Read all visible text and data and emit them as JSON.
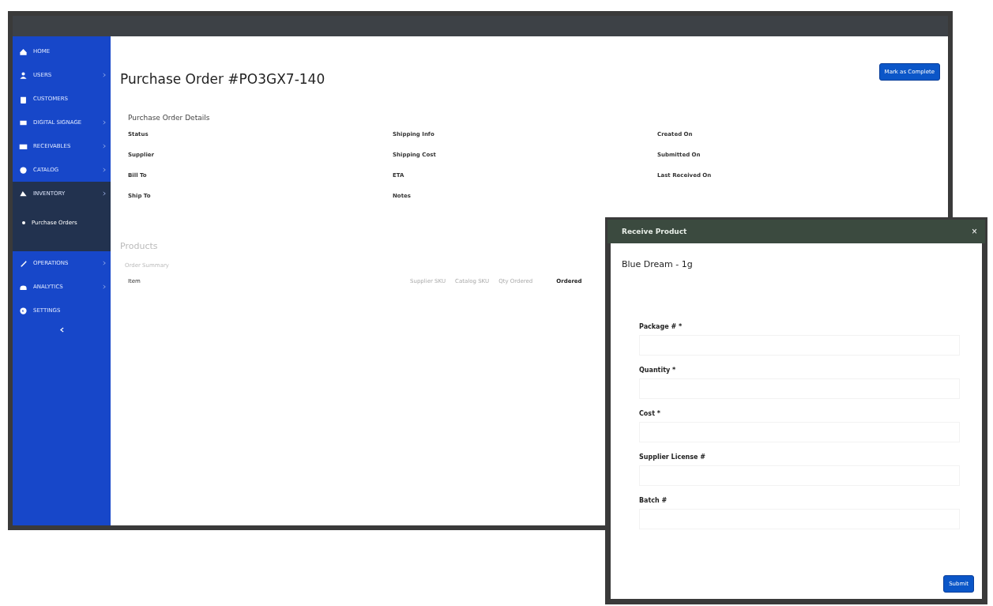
{
  "sidebar": {
    "items": [
      {
        "label": "HOME",
        "has_arrow": false,
        "expanded": false
      },
      {
        "label": "USERS",
        "has_arrow": true,
        "expanded": false
      },
      {
        "label": "CUSTOMERS",
        "has_arrow": false,
        "expanded": false
      },
      {
        "label": "DIGITAL SIGNAGE",
        "has_arrow": true,
        "expanded": false
      },
      {
        "label": "RECEIVABLES",
        "has_arrow": true,
        "expanded": false
      },
      {
        "label": "CATALOG",
        "has_arrow": true,
        "expanded": false
      },
      {
        "label": "INVENTORY",
        "has_arrow": true,
        "expanded": true,
        "children": [
          {
            "label": "Purchase Orders",
            "selected": true
          }
        ]
      },
      {
        "label": "OPERATIONS",
        "has_arrow": true,
        "expanded": false
      },
      {
        "label": "ANALYTICS",
        "has_arrow": true,
        "expanded": false
      },
      {
        "label": "SETTINGS",
        "has_arrow": false,
        "expanded": false
      }
    ]
  },
  "page": {
    "title": "Purchase Order #PO3GX7-140",
    "action_button": "Mark as Complete",
    "details": {
      "heading": "Purchase Order Details",
      "columns": [
        [
          "Status",
          "Supplier",
          "Bill To",
          "Ship To"
        ],
        [
          "Shipping Info",
          "Shipping Cost",
          "ETA",
          "Notes"
        ],
        [
          "Created On",
          "Submitted On",
          "Last Received On"
        ]
      ]
    },
    "products": {
      "heading": "Products",
      "subheading": "Order Summary",
      "columns": [
        "Item",
        "Supplier SKU",
        "Catalog SKU",
        "Qty Ordered",
        "Ordered"
      ]
    }
  },
  "modal": {
    "title": "Receive Product",
    "close": "×",
    "product": "Blue Dream - 1g",
    "fields": [
      "Package # *",
      "Quantity *",
      "Cost *",
      "Supplier License #",
      "Batch #"
    ],
    "submit": "Submit"
  }
}
